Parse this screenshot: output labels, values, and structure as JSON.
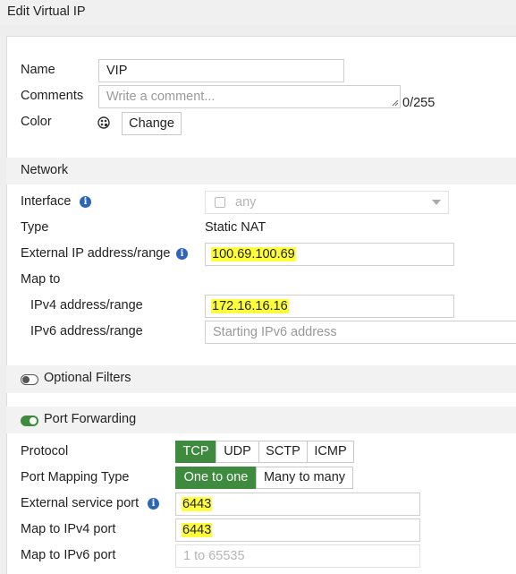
{
  "window": {
    "title": "Edit Virtual IP"
  },
  "general": {
    "name_label": "Name",
    "name_value": "VIP",
    "comments_label": "Comments",
    "comments_placeholder": "Write a comment...",
    "comments_counter": "0/255",
    "color_label": "Color",
    "color_change_button": "Change"
  },
  "network": {
    "section_title": "Network",
    "interface_label": "Interface",
    "interface_value": "any",
    "type_label": "Type",
    "type_value": "Static NAT",
    "external_ip_label": "External IP address/range",
    "external_ip_value": "100.69.100.69",
    "map_to_label": "Map to",
    "ipv4_label": "IPv4 address/range",
    "ipv4_value": "172.16.16.16",
    "ipv6_label": "IPv6 address/range",
    "ipv6_placeholder": "Starting IPv6 address"
  },
  "optional_filters": {
    "label": "Optional Filters",
    "enabled": false
  },
  "port_forwarding": {
    "label": "Port Forwarding",
    "enabled": true,
    "protocol_label": "Protocol",
    "protocols": [
      "TCP",
      "UDP",
      "SCTP",
      "ICMP"
    ],
    "protocol_selected": "TCP",
    "mapping_type_label": "Port Mapping Type",
    "mapping_types": [
      "One to one",
      "Many to many"
    ],
    "mapping_selected": "One to one",
    "external_port_label": "External service port",
    "external_port_value": "6443",
    "map_ipv4_port_label": "Map to IPv4 port",
    "map_ipv4_port_value": "6443",
    "map_ipv6_port_label": "Map to IPv6 port",
    "map_ipv6_port_placeholder": "1 to 65535"
  },
  "colors": {
    "accent_green": "#3e8a3e",
    "info_blue": "#2c66b8",
    "highlight": "#ffff3c"
  }
}
